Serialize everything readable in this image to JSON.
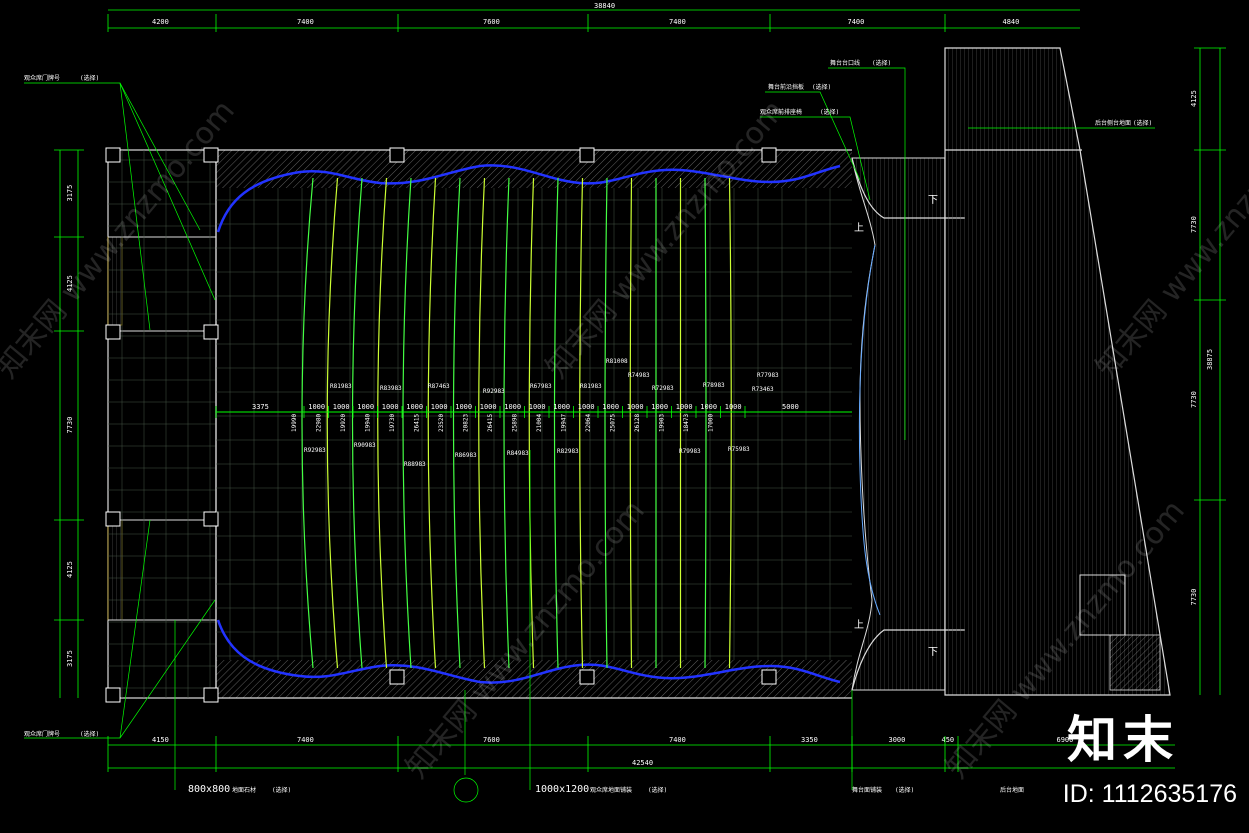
{
  "dimensions": {
    "top_total": "38840",
    "top_segments": [
      "4200",
      "7400",
      "7600",
      "7400",
      "7400",
      "4840"
    ],
    "bottom_segments": [
      "4150",
      "7400",
      "7600",
      "7400",
      "3350",
      "3000",
      "450",
      "6900"
    ],
    "bottom_total": "42540",
    "left_segments": [
      "3175",
      "4125",
      "7730",
      "4125",
      "3175"
    ],
    "right_segments": [
      "4125",
      "7730",
      "7730",
      "7730"
    ],
    "right_total": "38875",
    "row_spacing": [
      "3375",
      "1000",
      "1000",
      "1000",
      "1000",
      "1000",
      "1000",
      "1000",
      "1000",
      "1000",
      "1000",
      "1000",
      "1000",
      "1000",
      "1000",
      "1000",
      "1000",
      "1000",
      "1000",
      "5000"
    ]
  },
  "radius_labels_upper": [
    "R81983",
    "R83983",
    "R87463",
    "R92983",
    "R67983",
    "R81983",
    "R81008",
    "R74983",
    "R72983",
    "R78983",
    "R77983",
    "R73463"
  ],
  "radius_labels_lower": [
    "R92983",
    "R90983",
    "R88983",
    "R86983",
    "R84983",
    "R82983",
    "R79983",
    "R75983"
  ],
  "row_lengths": [
    "19990",
    "22980",
    "19920",
    "19940",
    "19730",
    "26415",
    "23520",
    "20823",
    "26415",
    "25898",
    "21004",
    "19947",
    "22064",
    "25075",
    "26128",
    "19903",
    "18473",
    "17000"
  ],
  "stage_marks": [
    "上",
    "下",
    "上",
    "下"
  ],
  "notes": {
    "left_top": "观众席门牌号",
    "left_top_tag": "(选择)",
    "left_bottom": "观众席门牌号",
    "left_bottom_tag": "(选择)",
    "top_right_1": "舞台台口线",
    "top_right_1_tag": "(选择)",
    "top_right_2": "舞台前沿挡板",
    "top_right_2_tag": "(选择)",
    "top_right_3": "观众席前排座椅",
    "top_right_3_tag": "(选择)",
    "stage_right": "后台侧台地面",
    "stage_right_tag": "(选择)",
    "bottom_1_size": "800x800",
    "bottom_1_text": "地面石材",
    "bottom_1_tag": "(选择)",
    "bottom_2_size": "1000x1200",
    "bottom_2_text": "观众席地面铺装",
    "bottom_2_tag": "(选择)",
    "bottom_3": "舞台面铺装",
    "bottom_3_tag": "(选择)",
    "bottom_4": "后台地面"
  },
  "watermark": "知末网 www.znzmo.com",
  "logo": "知末",
  "image_id": "ID: 1112635176",
  "colors": {
    "background": "#000000",
    "dimension": "#00ff00",
    "seat_rows": "#ccff33",
    "auditorium_edge": "#2233ff",
    "wall": "#ffffff",
    "grid": "#556655"
  }
}
